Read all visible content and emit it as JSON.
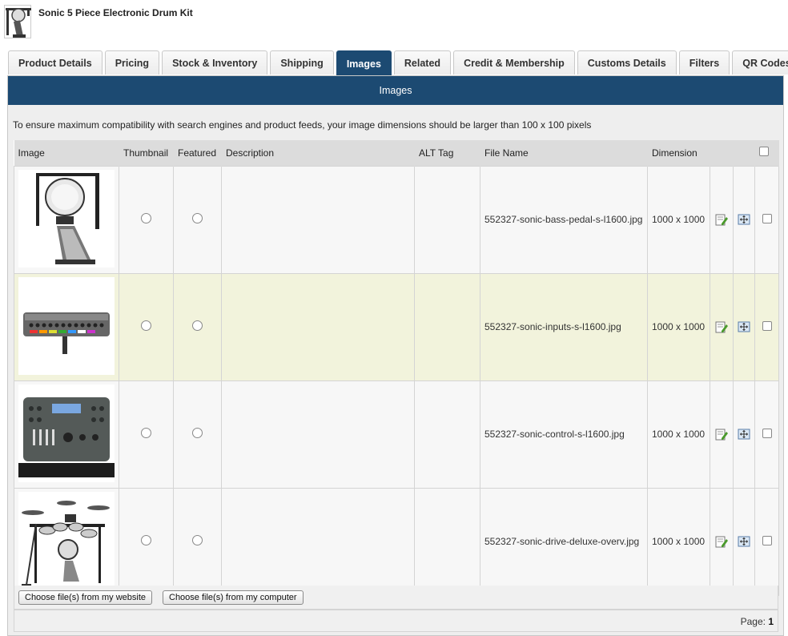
{
  "product": {
    "title": "Sonic 5 Piece Electronic Drum Kit",
    "thumb_icon": "drum-pedal-thumbnail"
  },
  "tabs": [
    {
      "label": "Product Details",
      "active": false
    },
    {
      "label": "Pricing",
      "active": false
    },
    {
      "label": "Stock & Inventory",
      "active": false
    },
    {
      "label": "Shipping",
      "active": false
    },
    {
      "label": "Images",
      "active": true
    },
    {
      "label": "Related",
      "active": false
    },
    {
      "label": "Credit & Membership",
      "active": false
    },
    {
      "label": "Customs Details",
      "active": false
    },
    {
      "label": "Filters",
      "active": false
    },
    {
      "label": "QR Codes",
      "active": false
    }
  ],
  "panel": {
    "heading": "Images",
    "note": "To ensure maximum compatibility with search engines and product feeds, your image dimensions should be larger than 100 x 100 pixels"
  },
  "table": {
    "columns": {
      "image": "Image",
      "thumbnail": "Thumbnail",
      "featured": "Featured",
      "description": "Description",
      "alt_tag": "ALT Tag",
      "file_name": "File Name",
      "dimension": "Dimension"
    },
    "rows": [
      {
        "image_icon": "bass-pedal-image",
        "description": "",
        "alt_tag": "",
        "file_name": "552327-sonic-bass-pedal-s-l1600.jpg",
        "dimension": "1000 x 1000"
      },
      {
        "image_icon": "inputs-module-image",
        "description": "",
        "alt_tag": "",
        "file_name": "552327-sonic-inputs-s-l1600.jpg",
        "dimension": "1000 x 1000"
      },
      {
        "image_icon": "control-module-image",
        "description": "",
        "alt_tag": "",
        "file_name": "552327-sonic-control-s-l1600.jpg",
        "dimension": "1000 x 1000"
      },
      {
        "image_icon": "drum-kit-overview-image",
        "description": "",
        "alt_tag": "",
        "file_name": "552327-sonic-drive-deluxe-overv.jpg",
        "dimension": "1000 x 1000"
      }
    ]
  },
  "buttons": {
    "from_website": "Choose file(s) from my website",
    "from_computer": "Choose file(s) from my computer"
  },
  "pager": {
    "label": "Page:",
    "current": "1"
  },
  "colors": {
    "accent": "#1c4a72",
    "row_highlight": "#f2f3dc"
  }
}
